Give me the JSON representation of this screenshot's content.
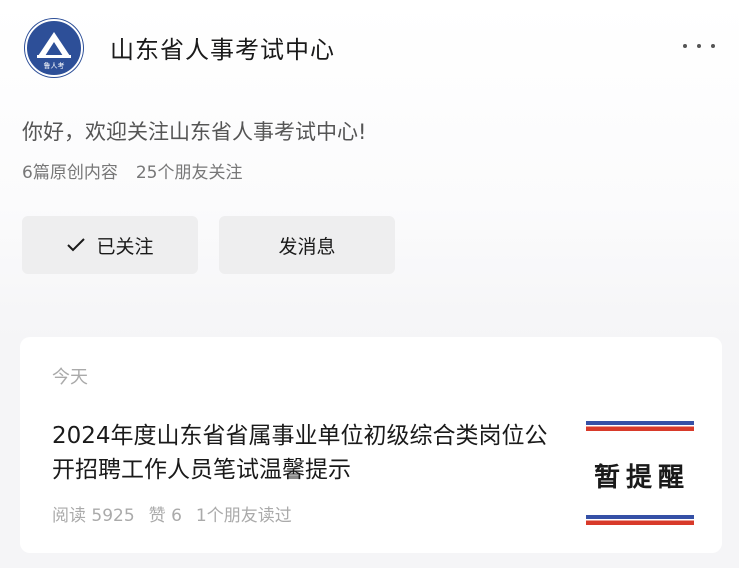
{
  "account": {
    "name": "山东省人事考试中心",
    "greeting": "你好，欢迎关注山东省人事考试中心!",
    "original_count": "6篇原创内容",
    "friends_following": "25个朋友关注",
    "logo_text": "鲁人考"
  },
  "actions": {
    "follow_label": "已关注",
    "message_label": "发消息"
  },
  "feed": {
    "day_label": "今天",
    "article": {
      "title": "2024年度山东省省属事业单位初级综合类岗位公开招聘工作人员笔试温馨提示",
      "reads": "阅读 5925",
      "likes": "赞 6",
      "friends_read": "1个朋友读过",
      "thumbnail_text": "暂提醒"
    }
  },
  "colors": {
    "avatar_bg": "#2d4f98",
    "stripe_blue": "#3550a6",
    "stripe_red": "#d83a2a"
  },
  "icons": {
    "more": "more-dots-icon",
    "follow": "checkmark-icon"
  }
}
